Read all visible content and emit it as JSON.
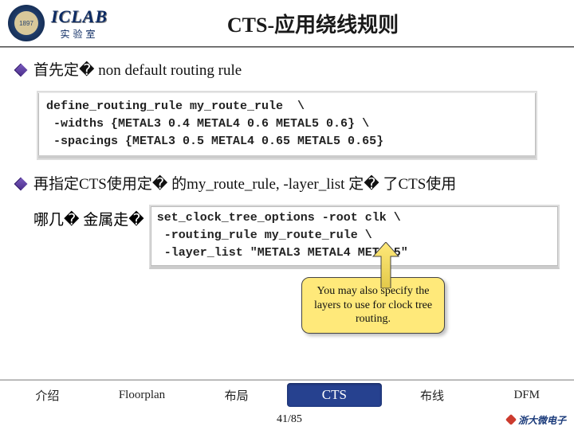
{
  "header": {
    "lab_top": "ICLAB",
    "lab_bottom": "实验室",
    "title": "CTS-应用绕线规则"
  },
  "bullets": {
    "b1": "首先定� non default routing rule",
    "b2_line1": "再指定CTS使用定� 的my_route_rule, -layer_list 定� 了CTS使用",
    "b2_line2": "哪几� 金属走�"
  },
  "code1": "define_routing_rule my_route_rule  \\\n -widths {METAL3 0.4 METAL4 0.6 METAL5 0.6} \\\n -spacings {METAL3 0.5 METAL4 0.65 METAL5 0.65}",
  "code2": "set_clock_tree_options -root clk \\\n -routing_rule my_route_rule \\\n -layer_list \"METAL3 METAL4 METAL5\"",
  "callout": "You may also specify the layers to use for clock tree routing.",
  "tabs": {
    "t1": "介绍",
    "t2": "Floorplan",
    "t3": "布局",
    "t4": "CTS",
    "t5": "布线",
    "t6": "DFM"
  },
  "footer": {
    "page": "41/85",
    "brand": "浙大微电子"
  }
}
